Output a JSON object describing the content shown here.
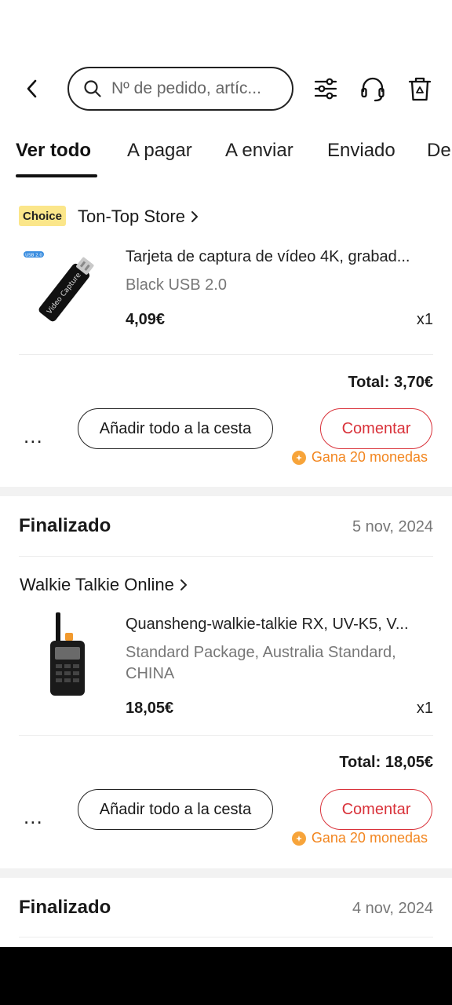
{
  "search": {
    "placeholder": "Nº de pedido, artíc..."
  },
  "tabs": [
    {
      "label": "Ver todo",
      "active": true
    },
    {
      "label": "A pagar"
    },
    {
      "label": "A enviar"
    },
    {
      "label": "Enviado"
    },
    {
      "label": "De"
    }
  ],
  "orders": [
    {
      "badge": "Choice",
      "store": "Ton-Top Store",
      "item": {
        "title": "Tarjeta de captura de vídeo 4K, grabad...",
        "variant": "Black USB 2.0",
        "price": "4,09€",
        "qty": "x1",
        "image_label": "Video Capture",
        "image_tag": "USB 2.0"
      },
      "total": "Total: 3,70€",
      "more_label": "...",
      "add_to_cart_label": "Añadir todo a la cesta",
      "comment_label": "Comentar",
      "coins_label": "Gana 20 monedas"
    },
    {
      "status": "Finalizado",
      "date": "5 nov, 2024",
      "store": "Walkie Talkie Online",
      "item": {
        "title": "Quansheng-walkie-talkie RX, UV-K5, V...",
        "variant": "Standard Package, Australia Standard, CHINA",
        "price": "18,05€",
        "qty": "x1"
      },
      "total": "Total: 18,05€",
      "more_label": "...",
      "add_to_cart_label": "Añadir todo a la cesta",
      "comment_label": "Comentar",
      "coins_label": "Gana 20 monedas"
    },
    {
      "status": "Finalizado",
      "date": "4 nov, 2024"
    }
  ],
  "colors": {
    "accent_red": "#d9323a",
    "coins_orange": "#f2851e",
    "choice_yellow": "#fbe68a"
  }
}
